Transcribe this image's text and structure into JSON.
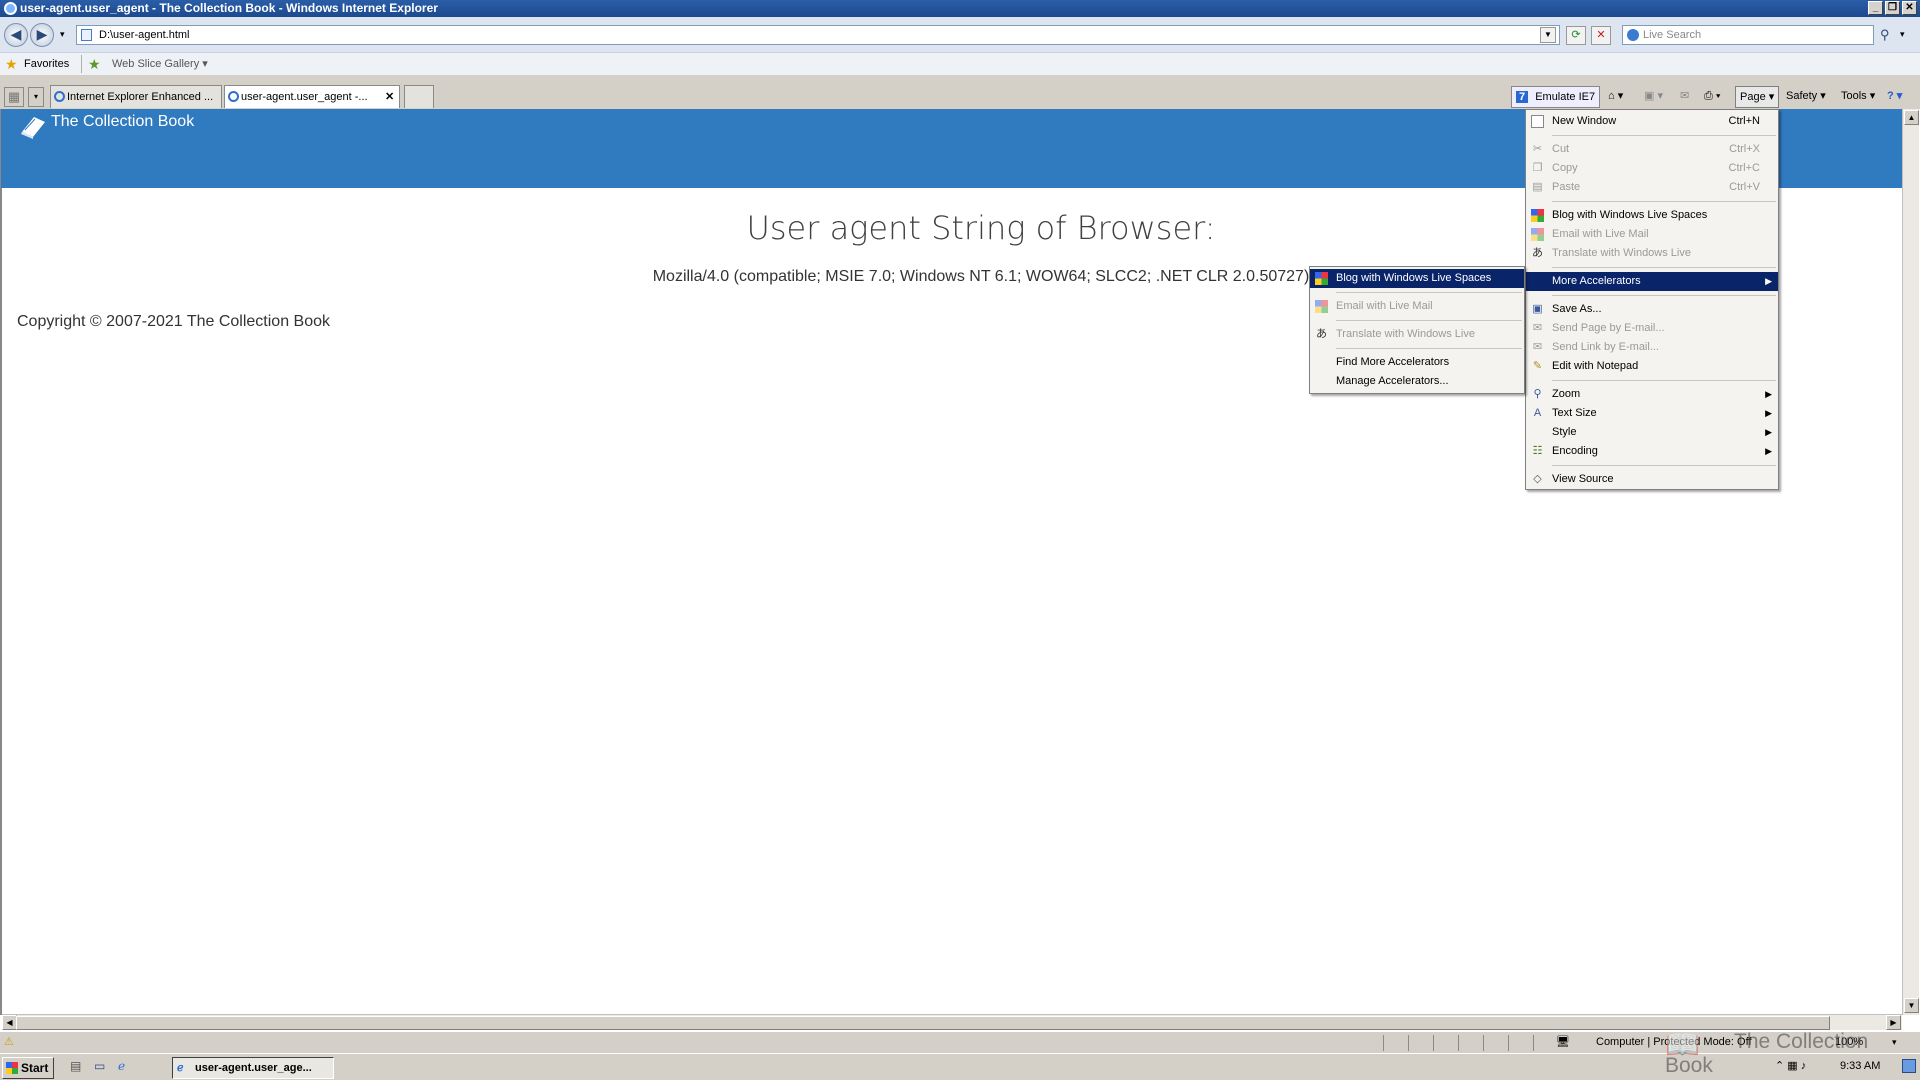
{
  "window": {
    "title": "user-agent.user_agent - The Collection Book - Windows Internet Explorer",
    "controls": [
      "_",
      "❐",
      "✕"
    ]
  },
  "address_bar": {
    "url": "D:\\user-agent.html",
    "search_placeholder": "Live Search"
  },
  "favorites_bar": {
    "favorites_label": "Favorites",
    "web_slice_label": "Web Slice Gallery ▾"
  },
  "tabs": [
    {
      "label": "Internet Explorer Enhanced ..."
    },
    {
      "label": "user-agent.user_agent -..."
    }
  ],
  "command_bar": {
    "emulate": "Emulate IE7",
    "page": "Page ▾",
    "safety": "Safety ▾",
    "tools": "Tools ▾"
  },
  "page": {
    "site_title": "The Collection Book",
    "heading": "User agent String of Browser:",
    "user_agent": "Mozilla/4.0 (compatible; MSIE 7.0; Windows NT 6.1; WOW64; SLCC2; .NET CLR 2.0.50727)",
    "copyright": "Copyright © 2007-2021 The Collection Book"
  },
  "page_menu": {
    "new_window": {
      "label": "New Window",
      "shortcut": "Ctrl+N"
    },
    "cut": {
      "label": "Cut",
      "shortcut": "Ctrl+X"
    },
    "copy": {
      "label": "Copy",
      "shortcut": "Ctrl+C"
    },
    "paste": {
      "label": "Paste",
      "shortcut": "Ctrl+V"
    },
    "blog": "Blog with Windows Live Spaces",
    "email": "Email with Live Mail",
    "translate": "Translate with Windows Live",
    "more_accelerators": "More Accelerators",
    "save_as": "Save As...",
    "send_page": "Send Page by E-mail...",
    "send_link": "Send Link by E-mail...",
    "edit_notepad": "Edit with Notepad",
    "zoom": "Zoom",
    "text_size": "Text Size",
    "style": "Style",
    "encoding": "Encoding",
    "view_source": "View Source"
  },
  "accelerators_submenu": {
    "blog": "Blog with Windows Live Spaces",
    "email": "Email with Live Mail",
    "translate": "Translate with Windows Live",
    "find_more": "Find More Accelerators",
    "manage": "Manage Accelerators..."
  },
  "status_bar": {
    "zone": "Computer | Protected Mode: Off",
    "zoom": "100%"
  },
  "taskbar": {
    "start": "Start",
    "active_item": "user-agent.user_age...",
    "clock": "9:33 AM"
  },
  "watermark": "The Collection Book",
  "colors": {
    "banner": "#307ac0",
    "menu_highlight": "#0a246a"
  }
}
